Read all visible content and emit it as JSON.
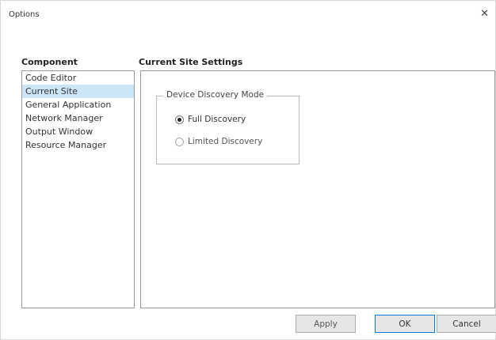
{
  "window": {
    "title": "Options",
    "close_icon": "close-icon",
    "close_glyph": "✕"
  },
  "component": {
    "label": "Component",
    "items": [
      {
        "label": "Code Editor",
        "selected": false
      },
      {
        "label": "Current Site",
        "selected": true
      },
      {
        "label": "General Application",
        "selected": false
      },
      {
        "label": "Network Manager",
        "selected": false
      },
      {
        "label": "Output Window",
        "selected": false
      },
      {
        "label": "Resource Manager",
        "selected": false
      }
    ]
  },
  "settings": {
    "heading": "Current Site Settings",
    "group": {
      "legend": "Device Discovery Mode",
      "options": [
        {
          "label": "Full Discovery",
          "checked": true
        },
        {
          "label": "Limited Discovery",
          "checked": false
        }
      ]
    }
  },
  "buttons": {
    "apply": "Apply",
    "ok": "OK",
    "cancel": "Cancel"
  },
  "colors": {
    "selection": "#cde6f7",
    "default_button_border": "#0078d7"
  }
}
